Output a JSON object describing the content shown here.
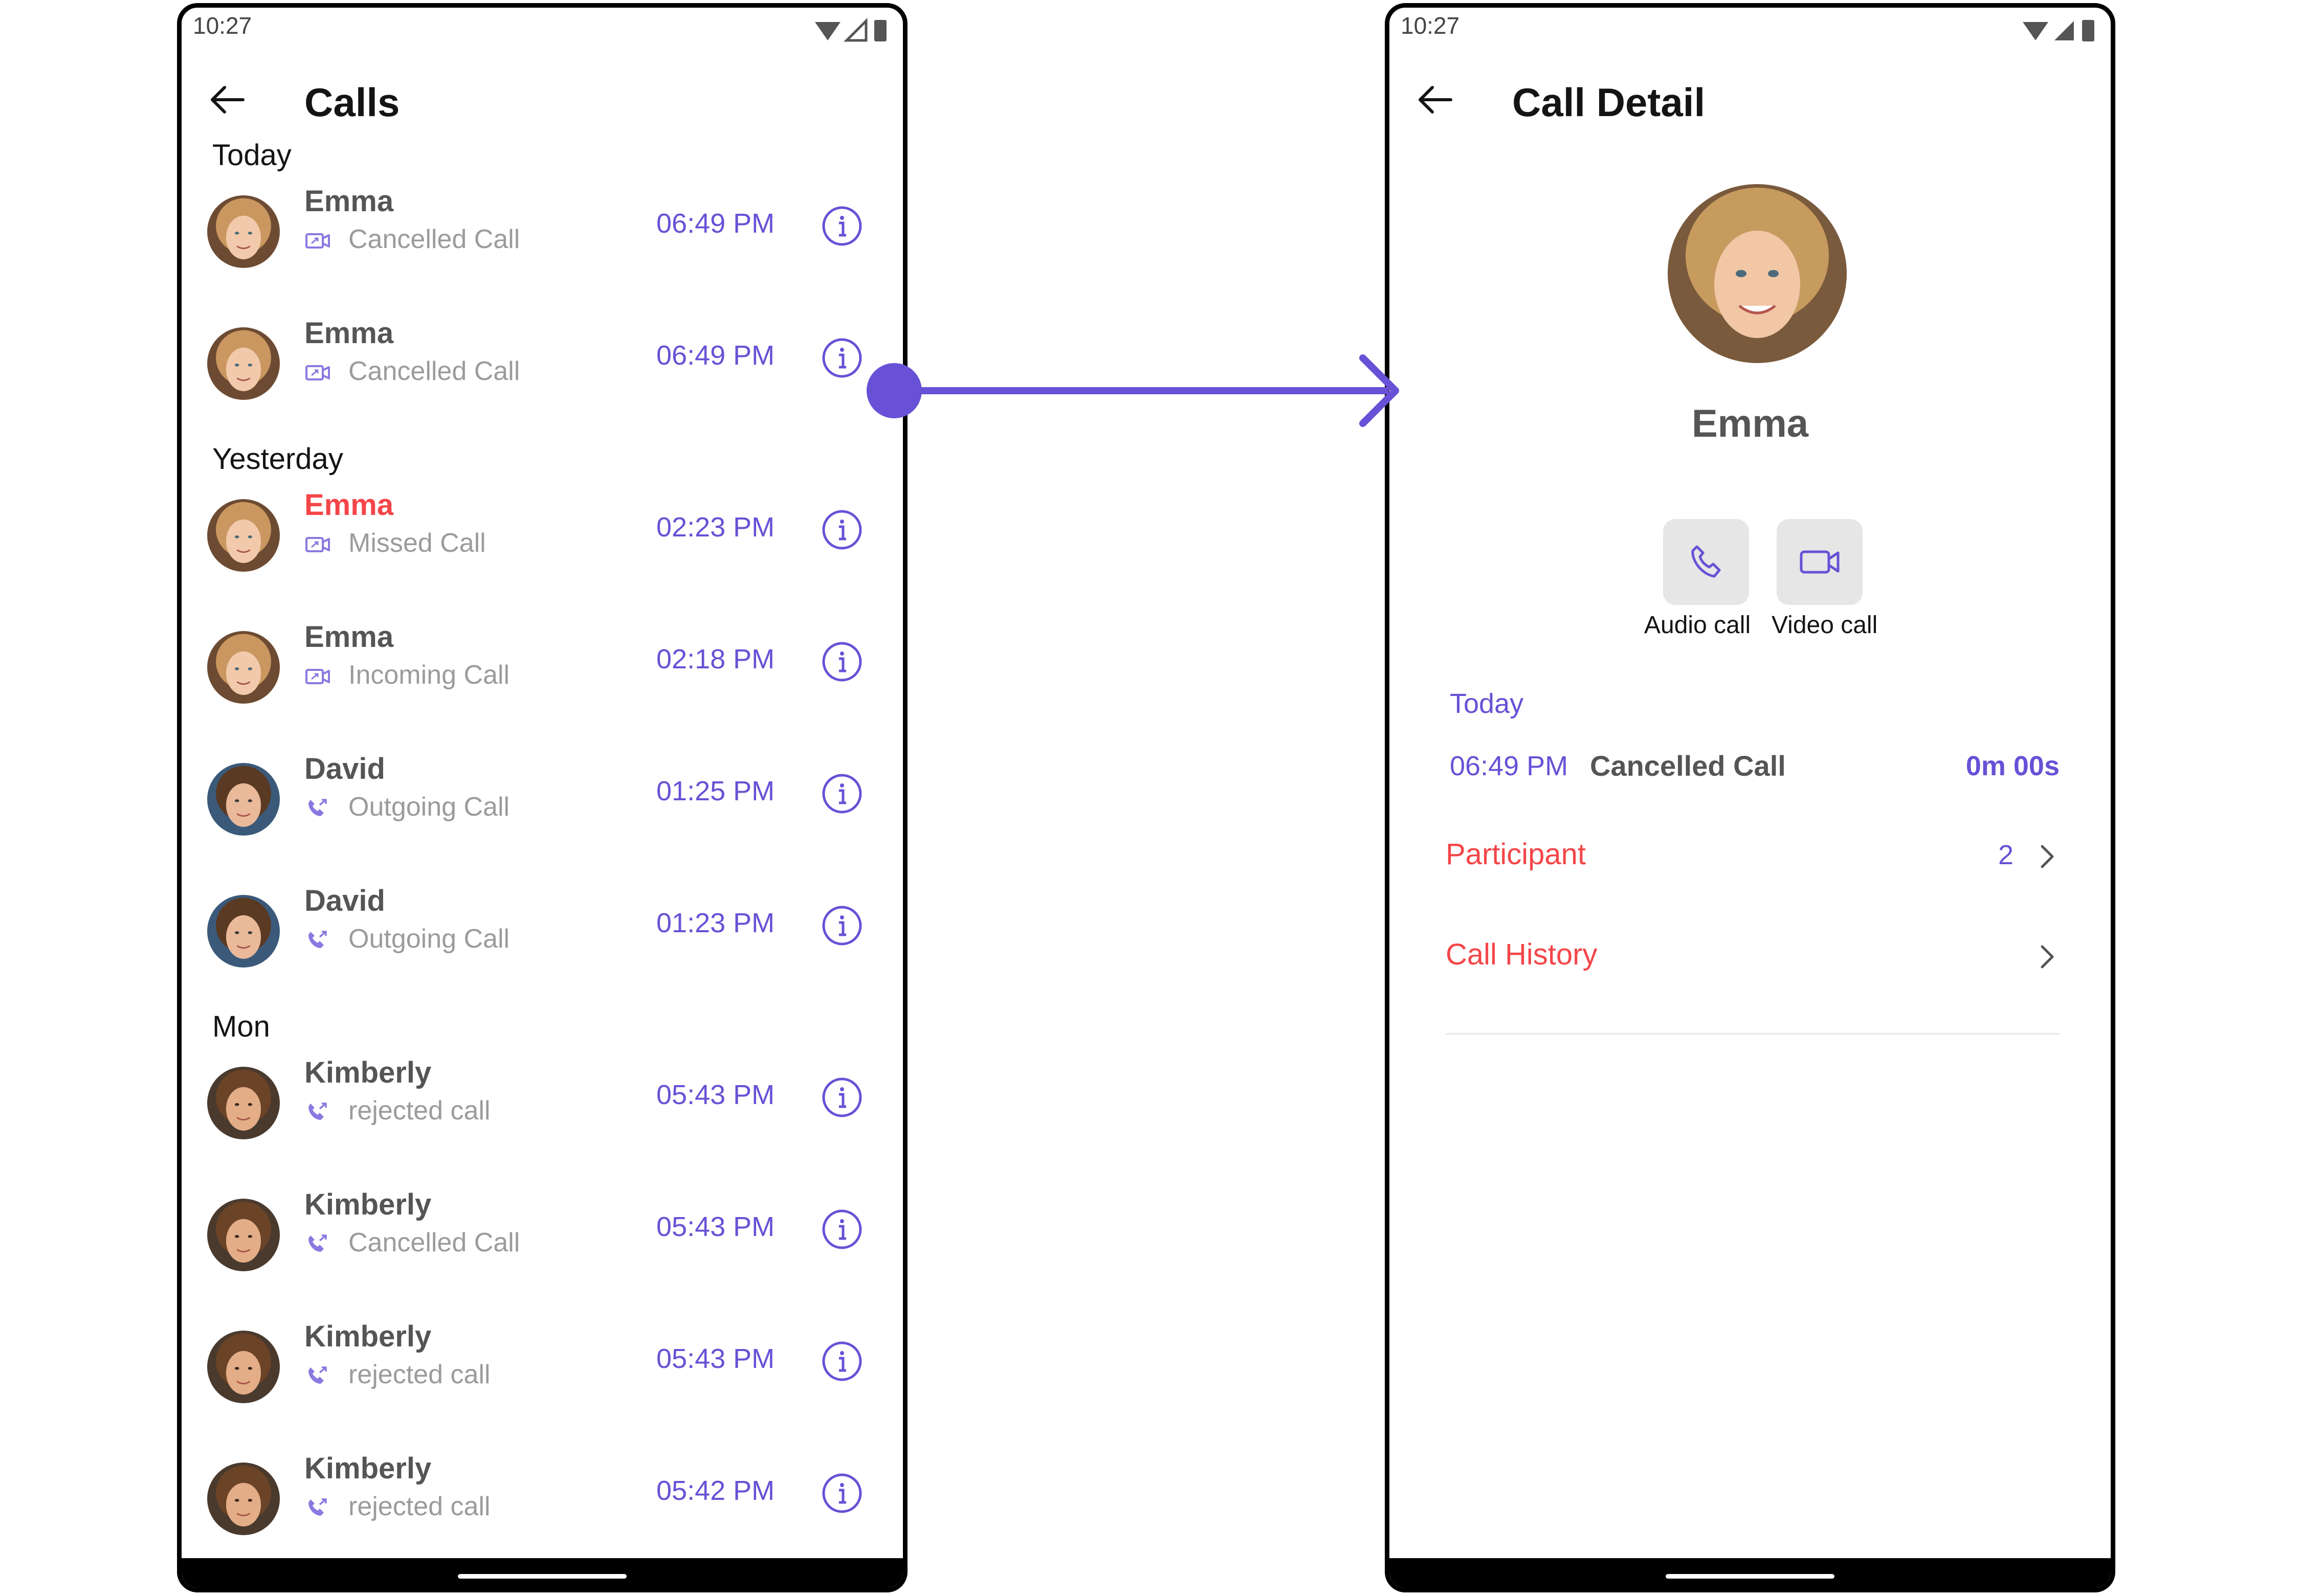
{
  "left": {
    "status_time": "10:27",
    "title": "Calls",
    "sections": [
      {
        "label": "Today",
        "rows": [
          {
            "name": "Emma",
            "type": "Cancelled Call",
            "time": "06:49 PM",
            "icon": "video-call-icon",
            "missed": false,
            "avatar": "emma"
          },
          {
            "name": "Emma",
            "type": "Cancelled Call",
            "time": "06:49 PM",
            "icon": "video-call-icon",
            "missed": false,
            "avatar": "emma"
          }
        ]
      },
      {
        "label": "Yesterday",
        "rows": [
          {
            "name": "Emma",
            "type": "Missed Call",
            "time": "02:23 PM",
            "icon": "video-call-icon",
            "missed": true,
            "avatar": "emma"
          },
          {
            "name": "Emma",
            "type": "Incoming Call",
            "time": "02:18 PM",
            "icon": "video-call-icon",
            "missed": false,
            "avatar": "emma"
          },
          {
            "name": "David",
            "type": "Outgoing Call",
            "time": "01:25 PM",
            "icon": "audio-call-icon",
            "missed": false,
            "avatar": "david"
          },
          {
            "name": "David",
            "type": "Outgoing Call",
            "time": "01:23 PM",
            "icon": "audio-call-icon",
            "missed": false,
            "avatar": "david"
          }
        ]
      },
      {
        "label": "Mon",
        "rows": [
          {
            "name": "Kimberly",
            "type": "rejected call",
            "time": "05:43 PM",
            "icon": "audio-call-icon",
            "missed": false,
            "avatar": "kimberly"
          },
          {
            "name": "Kimberly",
            "type": "Cancelled Call",
            "time": "05:43 PM",
            "icon": "audio-call-icon",
            "missed": false,
            "avatar": "kimberly"
          },
          {
            "name": "Kimberly",
            "type": "rejected call",
            "time": "05:43 PM",
            "icon": "audio-call-icon",
            "missed": false,
            "avatar": "kimberly"
          },
          {
            "name": "Kimberly",
            "type": "rejected call",
            "time": "05:42 PM",
            "icon": "audio-call-icon",
            "missed": false,
            "avatar": "kimberly"
          }
        ]
      }
    ]
  },
  "right": {
    "status_time": "10:27",
    "title": "Call Detail",
    "name": "Emma",
    "audio_label": "Audio call",
    "video_label": "Video call",
    "day_label": "Today",
    "log": {
      "time": "06:49 PM",
      "type": "Cancelled Call",
      "duration": "0m 00s"
    },
    "participant_label": "Participant",
    "participant_count": "2",
    "history_label": "Call History"
  },
  "colors": {
    "accent": "#6851d6",
    "missed": "#f44649",
    "text": "#141414",
    "secondary": "#9b9b9b",
    "button_bg": "#e6e6e6"
  }
}
